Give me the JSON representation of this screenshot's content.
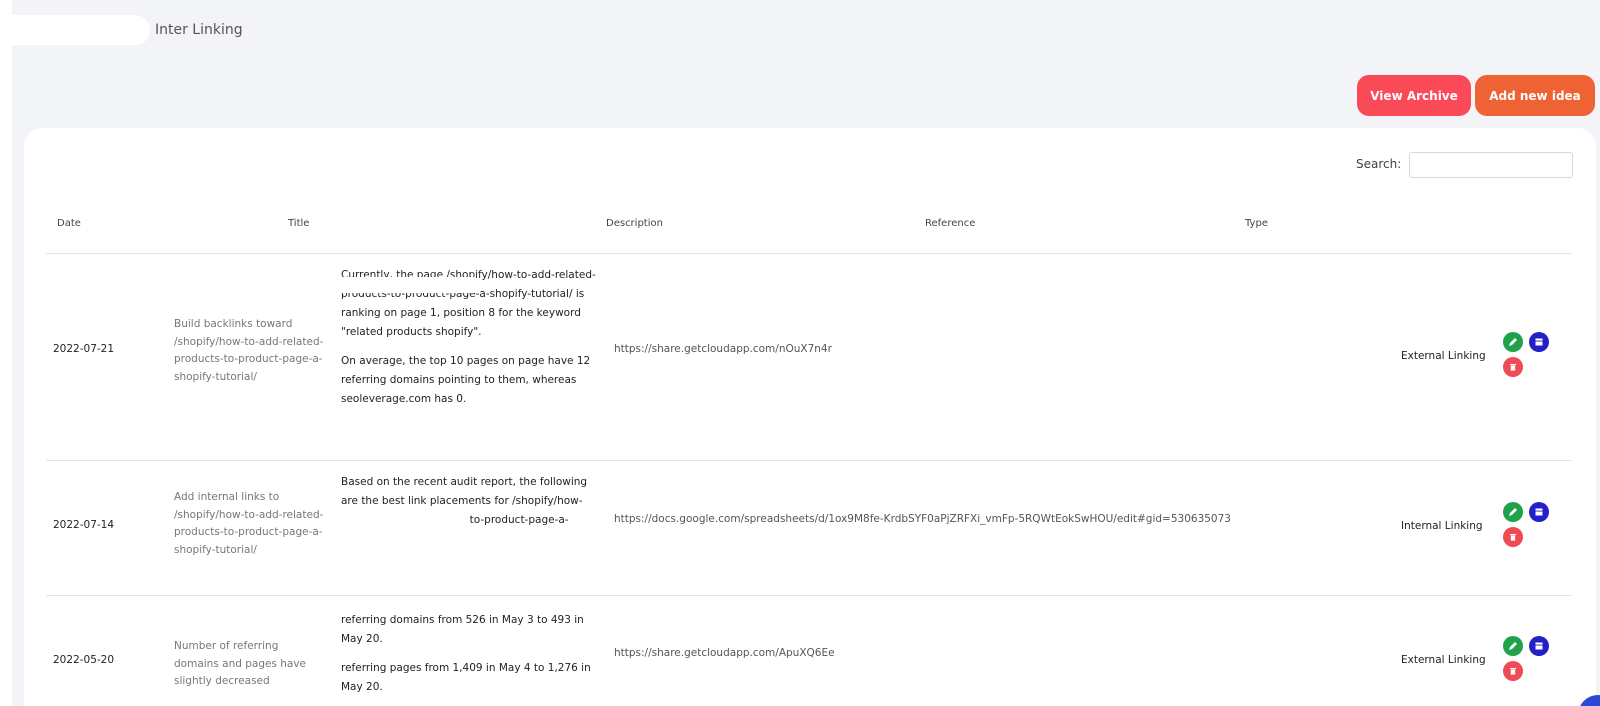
{
  "breadcrumb": {
    "current": "Inter Linking"
  },
  "buttons": {
    "view_archive": "View Archive",
    "add_new_idea": "Add new idea"
  },
  "search": {
    "label": "Search:",
    "value": "",
    "placeholder": ""
  },
  "table": {
    "headers": {
      "date": "Date",
      "title": "Title",
      "description": "Description",
      "reference": "Reference",
      "type": "Type"
    },
    "rows": [
      {
        "date": "2022-07-21",
        "title": "Build backlinks toward /shopify/how-to-add-related-products-to-product-page-a-shopify-tutorial/",
        "description": [
          "Currently, the page /shopify/how-to-add-related-products-to-product-page-a-shopify-tutorial/ is ranking on page 1, position 8 for the keyword \"related products shopify\".",
          "On average, the top 10 pages on page have 12 referring domains pointing to them, whereas seoleverage.com has 0."
        ],
        "reference": "https://share.getcloudapp.com/nOuX7n4r",
        "type": "External Linking"
      },
      {
        "date": "2022-07-14",
        "title": "Add internal links to /shopify/how-to-add-related-products-to-product-page-a-shopify-tutorial/",
        "description": [
          "Based on the recent audit report, the following are the best link placements for /shopify/how-to-add-related-products-to-product-page-a-shopify-tutorial/."
        ],
        "reference": "https://docs.google.com/spreadsheets/d/1ox9M8fe-KrdbSYF0aPjZRFXi_vmFp-5RQWtEokSwHOU/edit#gid=530635073",
        "type": "Internal Linking"
      },
      {
        "date": "2022-05-20",
        "title": "Number of referring domains and pages have slightly decreased",
        "description": [
          "referring domains from 526 in May 3 to 493 in May 20.",
          "referring pages from 1,409 in May 4 to 1,276 in May 20."
        ],
        "reference": "https://share.getcloudapp.com/ApuXQ6Ee",
        "type": "External Linking"
      }
    ]
  },
  "icons": {
    "edit": "pencil-icon",
    "archive": "archive-icon",
    "delete": "trash-icon"
  },
  "colors": {
    "archive_btn": "#fb4a57",
    "add_btn": "#ee6233",
    "edit": "#1fa24a",
    "archive": "#2320c8",
    "delete": "#f04b55"
  }
}
